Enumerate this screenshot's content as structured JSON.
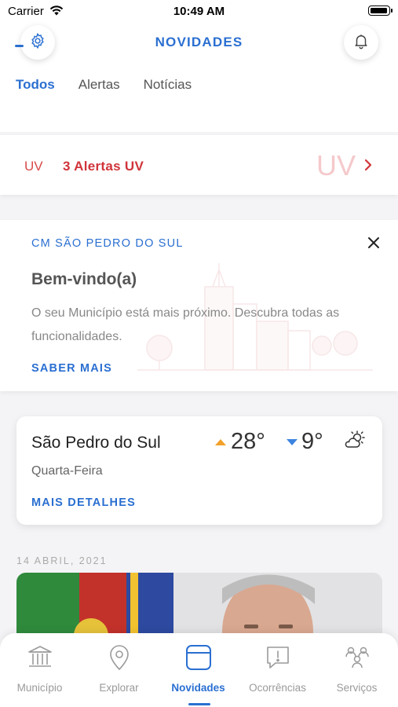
{
  "status_bar": {
    "carrier": "Carrier",
    "time": "10:49 AM"
  },
  "header": {
    "title": "NOVIDADES",
    "left_icon": "gear-icon",
    "right_icon": "bell-icon"
  },
  "tabs": [
    {
      "label": "Todos",
      "active": true
    },
    {
      "label": "Alertas",
      "active": false
    },
    {
      "label": "Notícias",
      "active": false
    }
  ],
  "uv_alert": {
    "short": "UV",
    "text": "3 Alertas UV",
    "watermark": "UV",
    "color": "#d0343a"
  },
  "welcome": {
    "org": "CM SÃO PEDRO DO SUL",
    "title": "Bem-vindo(a)",
    "text": "O seu Município está mais próximo. Descubra todas as funcionalidades.",
    "link": "SABER MAIS"
  },
  "weather": {
    "city": "São Pedro do Sul",
    "day": "Quarta-Feira",
    "high": "28°",
    "low": "9°",
    "condition_icon": "partly-cloudy-icon",
    "link": "MAIS DETALHES"
  },
  "news": {
    "date": "14 ABRIL, 2021"
  },
  "bottom_nav": [
    {
      "label": "Município",
      "icon": "building-icon",
      "active": false
    },
    {
      "label": "Explorar",
      "icon": "map-pin-icon",
      "active": false
    },
    {
      "label": "Novidades",
      "icon": "news-icon",
      "active": true
    },
    {
      "label": "Ocorrências",
      "icon": "alert-message-icon",
      "active": false
    },
    {
      "label": "Serviços",
      "icon": "services-icon",
      "active": false
    }
  ],
  "colors": {
    "accent": "#2a6fd1",
    "alert": "#d0343a",
    "high_temp": "#f2a12a",
    "low_temp": "#3e84e0"
  }
}
